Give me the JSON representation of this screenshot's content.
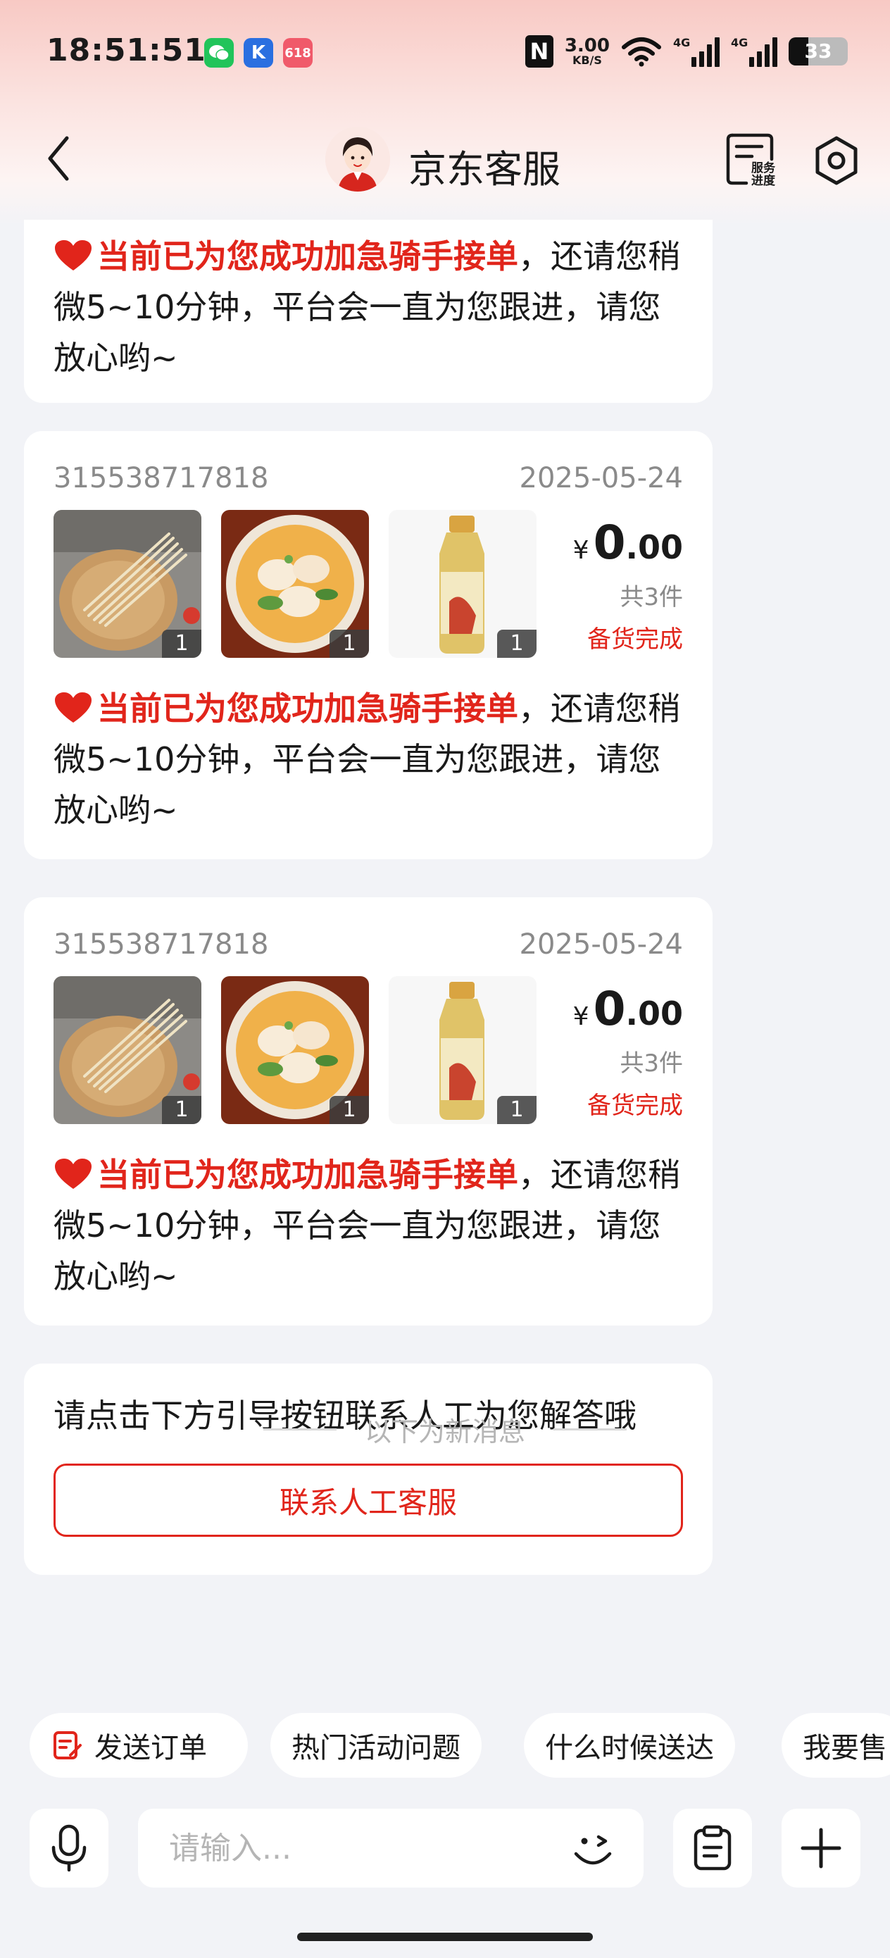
{
  "status_bar": {
    "time": "18:51:51",
    "nfc": "N",
    "net_speed_value": "3.00",
    "net_speed_unit": "KB/S",
    "sim1_type": "4G",
    "sim2_type": "4G",
    "battery_level": "33",
    "battery_fraction": 0.33,
    "shop_icon_text": "618",
    "k_icon_text": "K"
  },
  "header": {
    "title": "京东客服",
    "progress_label_line1": "服务",
    "progress_label_line2": "进度"
  },
  "messages": {
    "partial": {
      "highlight": "当前已为您成功加急骑手接单",
      "text_after": "，还请您稍微5~10分钟，平台会一直为您跟进，请您放心哟~"
    },
    "orders": [
      {
        "order_id": "315538717818",
        "date": "2025-05-24",
        "items": [
          {
            "name": "noodles",
            "qty": "1"
          },
          {
            "name": "wonton-soup",
            "qty": "1"
          },
          {
            "name": "tea-bottle",
            "qty": "1"
          }
        ],
        "currency": "¥",
        "price_int": "0",
        "price_dec": ".00",
        "count": "共3件",
        "status": "备货完成",
        "highlight": "当前已为您成功加急骑手接单",
        "text_after": "，还请您稍微5~10分钟，平台会一直为您跟进，请您放心哟~"
      },
      {
        "order_id": "315538717818",
        "date": "2025-05-24",
        "items": [
          {
            "name": "noodles",
            "qty": "1"
          },
          {
            "name": "wonton-soup",
            "qty": "1"
          },
          {
            "name": "tea-bottle",
            "qty": "1"
          }
        ],
        "currency": "¥",
        "price_int": "0",
        "price_dec": ".00",
        "count": "共3件",
        "status": "备货完成",
        "highlight": "当前已为您成功加急骑手接单",
        "text_after": "，还请您稍微5~10分钟，平台会一直为您跟进，请您放心哟~"
      }
    ],
    "cta": {
      "text": "请点击下方引导按钮联系人工为您解答哦",
      "button": "联系人工客服"
    },
    "divider": "以下为新消息"
  },
  "quick_chips": [
    "发送订单",
    "热门活动问题",
    "什么时候送达",
    "我要售"
  ],
  "input": {
    "placeholder": "请输入..."
  },
  "colors": {
    "accent": "#e1251b",
    "background": "#f2f3f7",
    "card": "#ffffff",
    "muted": "#8a8a8a"
  }
}
